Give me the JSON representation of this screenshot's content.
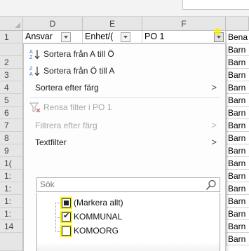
{
  "columns": [
    {
      "letter": "D",
      "key": "col_d"
    },
    {
      "letter": "E",
      "key": "col_e"
    },
    {
      "letter": "F",
      "key": "col_f"
    }
  ],
  "header_row": {
    "row_number": "1",
    "ansvar": "Ansvar",
    "enhet": "Enhet/(",
    "po1": "PO 1",
    "g_col": "Bena"
  },
  "row_numbers": [
    "2",
    "3",
    "4",
    "5",
    "6",
    "7",
    "8",
    "9",
    "1(",
    "1:",
    "1:",
    "1:",
    "1:",
    "14"
  ],
  "g_column_values": [
    "Barn",
    "Barn",
    "Barn",
    "Barn",
    "Barn",
    "Barn",
    "Barn",
    "Barn",
    "Barn",
    "Barn",
    "Barn",
    "Barn",
    "Barn",
    "Barn",
    "Barn",
    "Barn"
  ],
  "menu": {
    "sort_asc": "Sortera från A till Ö",
    "sort_desc": "Sortera från Ö till A",
    "sort_by_color": "Sortera efter färg",
    "clear_filter": "Rensa filter i PO 1",
    "filter_by_color": "Filtrera efter färg",
    "text_filter": "Textfilter",
    "search_placeholder": "Sök",
    "tree_items": {
      "select_all": "(Markera allt)",
      "kommunal": "KOMMUNAL",
      "komoorg": "KOMOORG"
    }
  },
  "icons": {
    "sort_asc": "sort-asc-icon",
    "sort_desc": "sort-desc-icon",
    "clear_filter": "clear-filter-icon",
    "search": "search-icon",
    "submenu": "chevron-right-icon"
  },
  "colors": {
    "highlight_yellow": "#f7ee00",
    "sort_icon_blue": "#2b6cc4"
  }
}
